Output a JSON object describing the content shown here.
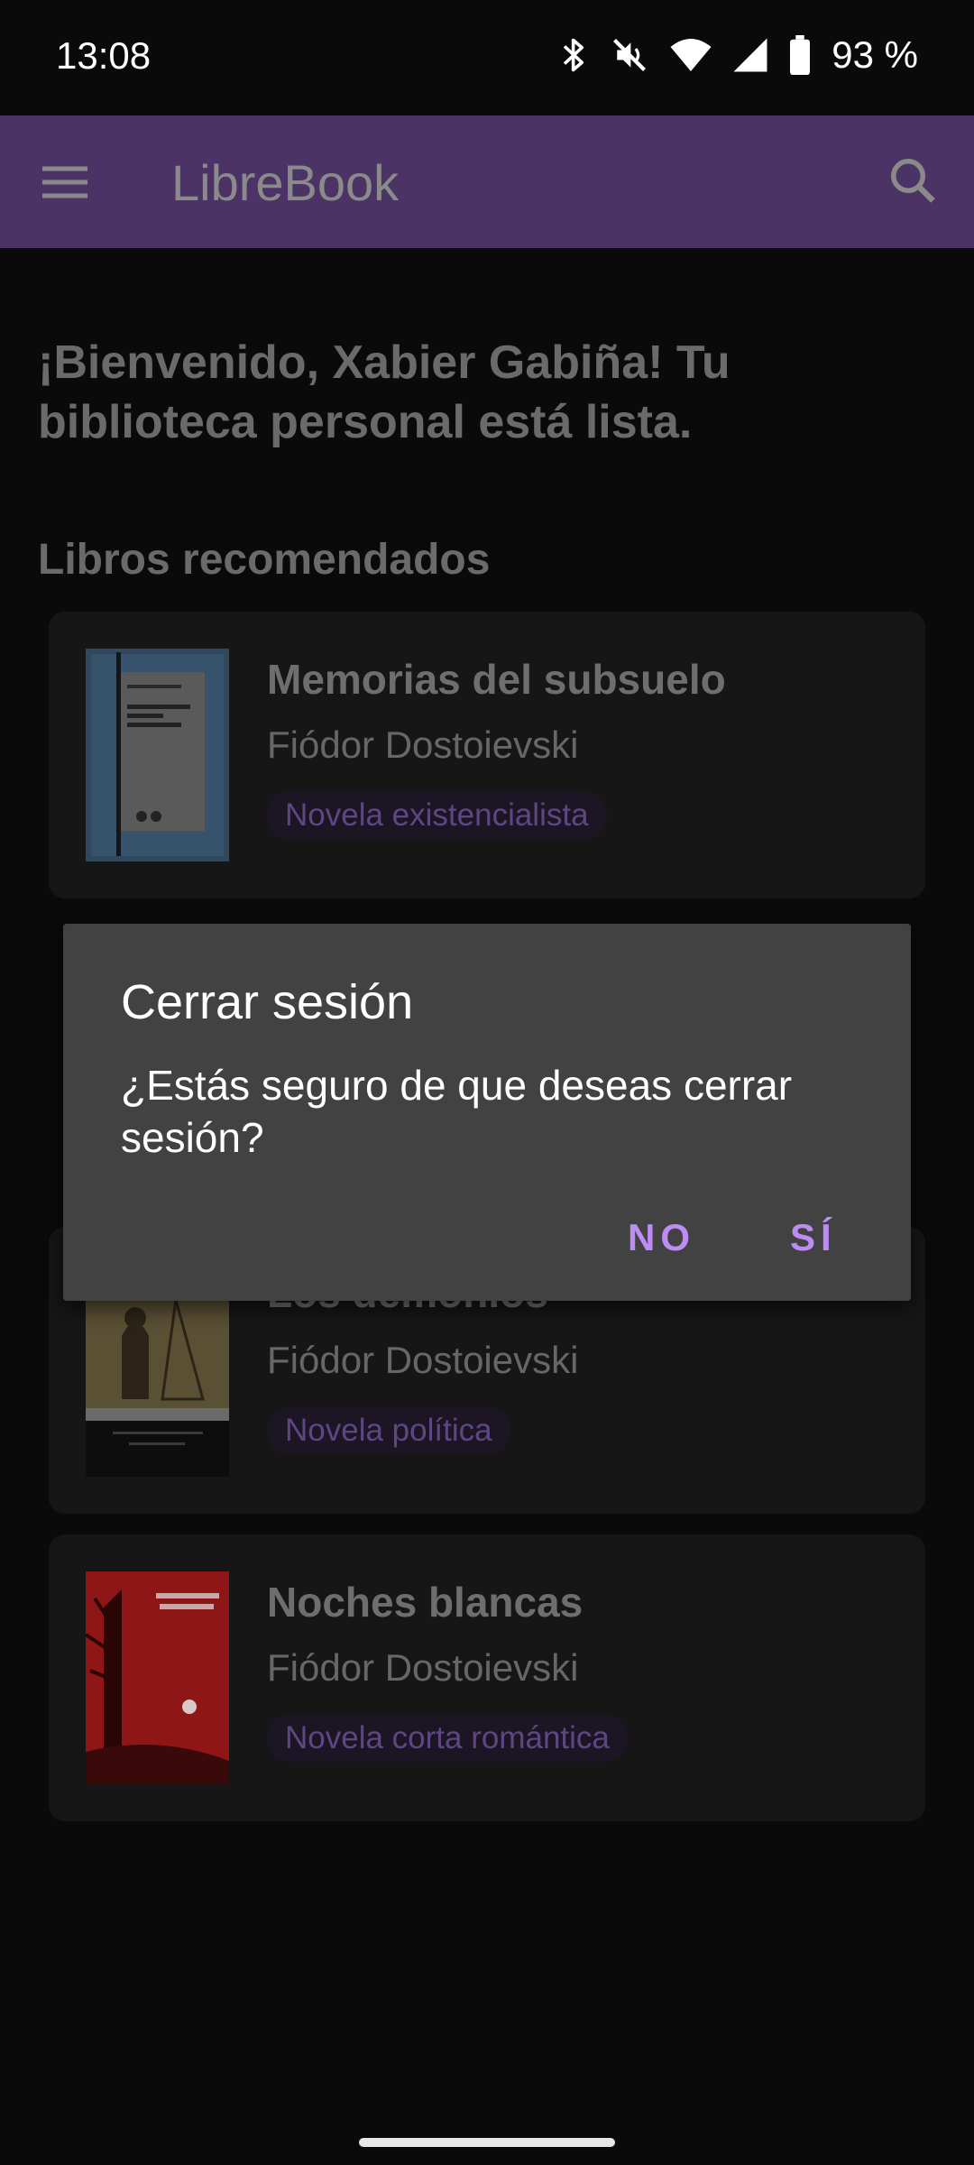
{
  "status_bar": {
    "time": "13:08",
    "battery": "93 %"
  },
  "app_bar": {
    "title": "LibreBook",
    "menu_icon": "hamburger-menu-icon",
    "search_icon": "search-icon"
  },
  "welcome_text": "¡Bienvenido, Xabier Gabiña! Tu biblioteca personal está lista.",
  "section_title": "Libros recomendados",
  "books": [
    {
      "title": "Memorias del subsuelo",
      "author": "Fiódor Dostoievski",
      "genre": "Novela existencialista"
    },
    {
      "title": "Los demonios",
      "author": "Fiódor Dostoievski",
      "genre": "Novela política"
    },
    {
      "title": "Noches blancas",
      "author": "Fiódor Dostoievski",
      "genre": "Novela corta romántica"
    }
  ],
  "dialog": {
    "title": "Cerrar sesión",
    "message": "¿Estás seguro de que deseas cerrar sesión?",
    "no_label": "NO",
    "yes_label": "SÍ"
  },
  "colors": {
    "app_bar": "#4b3366",
    "accent": "#bd8cf5",
    "dialog": "#424242",
    "background": "#0a0a0a"
  }
}
